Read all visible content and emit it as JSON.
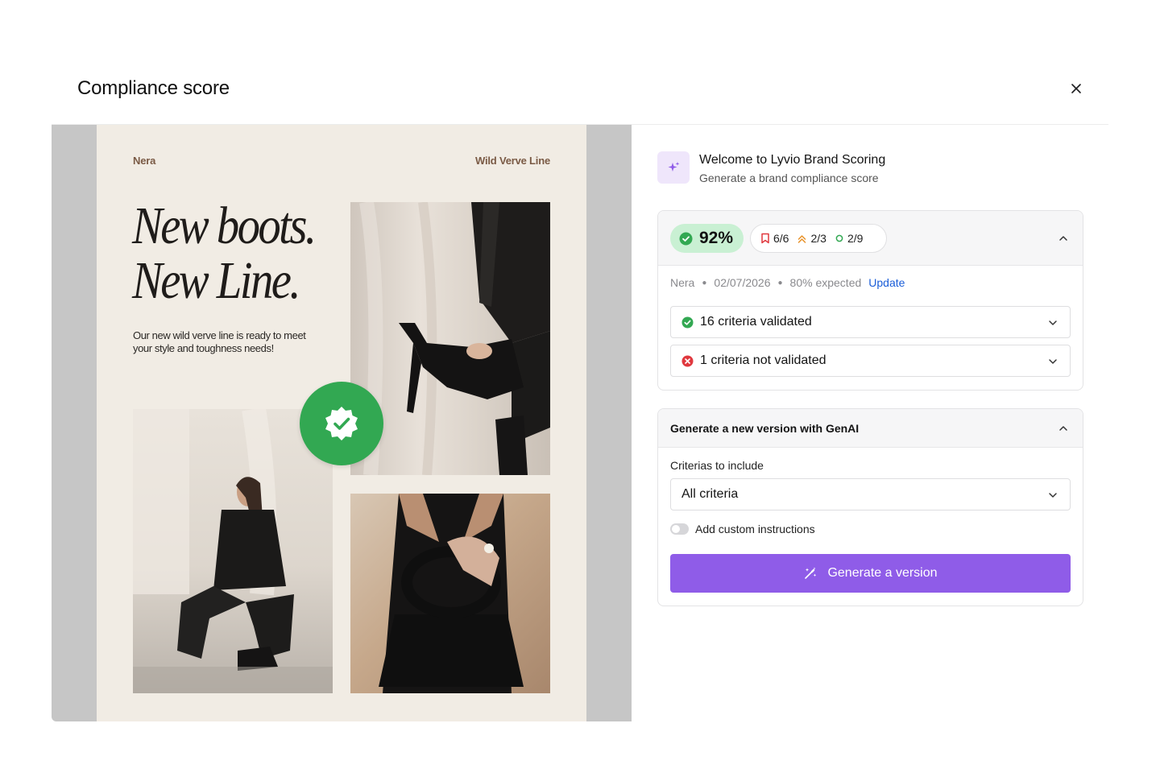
{
  "modal": {
    "title": "Compliance score"
  },
  "preview": {
    "brand": "Nera",
    "line_name": "Wild Verve Line",
    "headline_1": "New boots.",
    "headline_2": "New Line.",
    "tagline": "Our new wild verve line is ready to meet your style and toughness needs!"
  },
  "welcome": {
    "title": "Welcome to Lyvio Brand Scoring",
    "subtitle": "Generate a brand compliance score"
  },
  "score": {
    "percent": "92%",
    "stat_critical": "6/6",
    "stat_major": "2/3",
    "stat_minor": "2/9",
    "brand": "Nera",
    "date": "02/07/2026",
    "expected": "80% expected",
    "update_label": "Update",
    "validated_label": "16 criteria validated",
    "not_validated_label": "1 criteria not validated"
  },
  "genai": {
    "title": "Generate a new version with GenAI",
    "criteria_label": "Criterias to include",
    "criteria_value": "All criteria",
    "custom_instructions_label": "Add custom instructions",
    "custom_instructions_enabled": false,
    "button_label": "Generate a version"
  },
  "colors": {
    "accent": "#8f5ce8",
    "success": "#32a852",
    "score_bg": "#c9f0d3",
    "error": "#e0383e",
    "warning": "#e8922a",
    "link": "#1a5dd8"
  }
}
